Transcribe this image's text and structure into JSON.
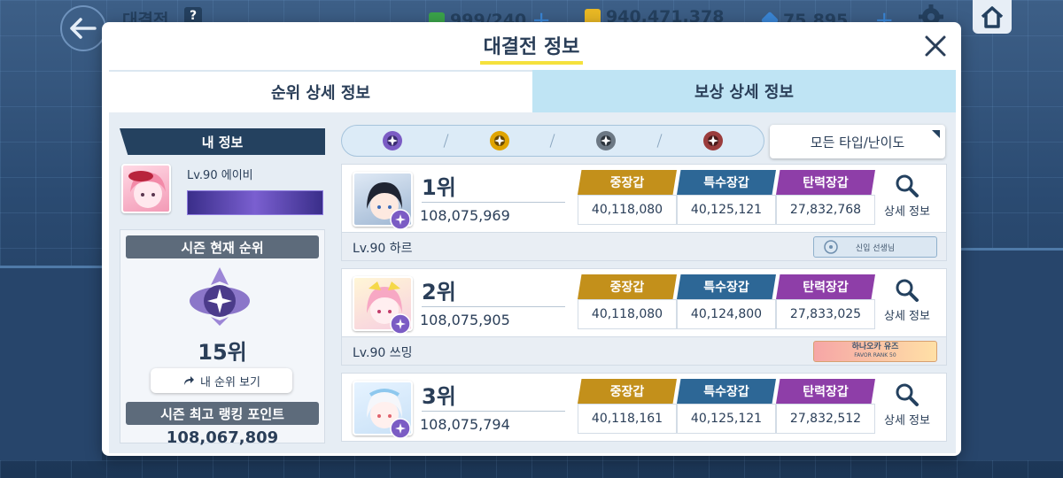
{
  "hud": {
    "title": "대결전",
    "help": "?",
    "ap": "999/240",
    "credits": "940,471,378",
    "pyroxene": "75,895"
  },
  "modal": {
    "title": "대결전 정보",
    "tabs": [
      {
        "label": "순위 상세 정보",
        "active": true
      },
      {
        "label": "보상 상세 정보",
        "active": false
      }
    ]
  },
  "my_info": {
    "header": "내 정보",
    "level_name": "Lv.90 에이비",
    "season_rank_header": "시즌 현재 순위",
    "season_rank": "15위",
    "my_rank_button": "내 순위 보기",
    "best_points_header": "시즌 최고 랭킹 포인트",
    "best_points": "108,067,809"
  },
  "filter": {
    "difficulties": [
      {
        "icon": "difficulty-purple-icon",
        "color": "#7b5cc4"
      },
      {
        "icon": "difficulty-gold-icon",
        "color": "#e0a400"
      },
      {
        "icon": "difficulty-gray-icon",
        "color": "#6c7884"
      },
      {
        "icon": "difficulty-red-icon",
        "color": "#9a3c3c"
      }
    ],
    "type_button": "모든 타입/난이도"
  },
  "stat_labels": [
    "중장갑",
    "특수장갑",
    "탄력장갑"
  ],
  "detail_label": "상세 정보",
  "rankings": [
    {
      "position": "1위",
      "score": "108,075,969",
      "heavy": "40,118,080",
      "special": "40,125,121",
      "elastic": "27,832,768",
      "name": "Lv.90 하르",
      "tag": "신입 선생님"
    },
    {
      "position": "2위",
      "score": "108,075,905",
      "heavy": "40,118,080",
      "special": "40,124,800",
      "elastic": "27,833,025",
      "name": "Lv.90 쓰밍",
      "tag": "하나오카 유즈",
      "tag_sub": "FAVOR RANK 50"
    },
    {
      "position": "3위",
      "score": "108,075,794",
      "heavy": "40,118,161",
      "special": "40,125,121",
      "elastic": "27,832,512"
    }
  ]
}
